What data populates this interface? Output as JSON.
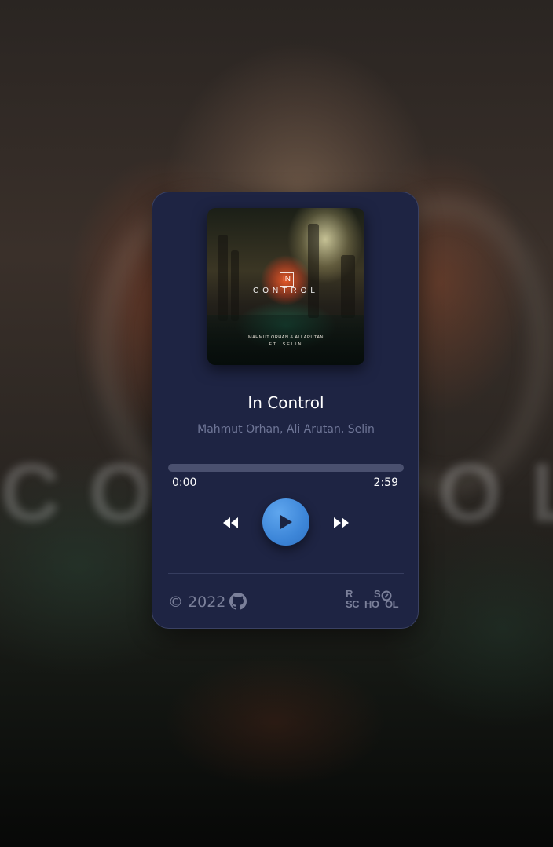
{
  "background": {
    "word": "CONTROL"
  },
  "player": {
    "cover": {
      "title_badge": "IN",
      "title": "CONTROL",
      "artist_line": "MAHMUT ORHAN & ALI ARUTAN",
      "feat_line": "FT. SELIN"
    },
    "track_title": "In Control",
    "track_artist": "Mahmut Orhan, Ali Arutan, Selin",
    "current_time": "0:00",
    "total_time": "2:59",
    "progress_fraction": 0.0,
    "state": "paused"
  },
  "footer": {
    "copyright": "© 2022",
    "school_logo": {
      "line1_left": "R",
      "line1_right": "S",
      "line2_left": "SC",
      "line2_mid": "HO",
      "line2_right": "OL"
    }
  },
  "icons": {
    "prev": "rewind-icon",
    "play": "play-icon",
    "next": "fast-forward-icon",
    "github": "github-icon"
  },
  "colors": {
    "card_bg": "#1e2443",
    "accent": "#3d86d8",
    "text_muted": "#6f7697",
    "progress_track": "#4a506f"
  }
}
